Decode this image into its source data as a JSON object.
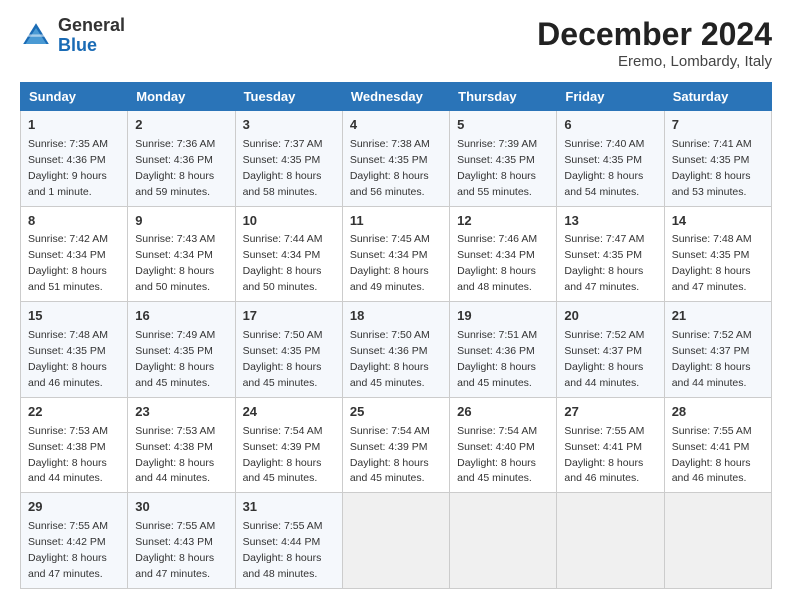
{
  "header": {
    "logo_line1": "General",
    "logo_line2": "Blue",
    "month": "December 2024",
    "location": "Eremo, Lombardy, Italy"
  },
  "days_of_week": [
    "Sunday",
    "Monday",
    "Tuesday",
    "Wednesday",
    "Thursday",
    "Friday",
    "Saturday"
  ],
  "weeks": [
    [
      {
        "day": "1",
        "info": "Sunrise: 7:35 AM\nSunset: 4:36 PM\nDaylight: 9 hours\nand 1 minute."
      },
      {
        "day": "2",
        "info": "Sunrise: 7:36 AM\nSunset: 4:36 PM\nDaylight: 8 hours\nand 59 minutes."
      },
      {
        "day": "3",
        "info": "Sunrise: 7:37 AM\nSunset: 4:35 PM\nDaylight: 8 hours\nand 58 minutes."
      },
      {
        "day": "4",
        "info": "Sunrise: 7:38 AM\nSunset: 4:35 PM\nDaylight: 8 hours\nand 56 minutes."
      },
      {
        "day": "5",
        "info": "Sunrise: 7:39 AM\nSunset: 4:35 PM\nDaylight: 8 hours\nand 55 minutes."
      },
      {
        "day": "6",
        "info": "Sunrise: 7:40 AM\nSunset: 4:35 PM\nDaylight: 8 hours\nand 54 minutes."
      },
      {
        "day": "7",
        "info": "Sunrise: 7:41 AM\nSunset: 4:35 PM\nDaylight: 8 hours\nand 53 minutes."
      }
    ],
    [
      {
        "day": "8",
        "info": "Sunrise: 7:42 AM\nSunset: 4:34 PM\nDaylight: 8 hours\nand 51 minutes."
      },
      {
        "day": "9",
        "info": "Sunrise: 7:43 AM\nSunset: 4:34 PM\nDaylight: 8 hours\nand 50 minutes."
      },
      {
        "day": "10",
        "info": "Sunrise: 7:44 AM\nSunset: 4:34 PM\nDaylight: 8 hours\nand 50 minutes."
      },
      {
        "day": "11",
        "info": "Sunrise: 7:45 AM\nSunset: 4:34 PM\nDaylight: 8 hours\nand 49 minutes."
      },
      {
        "day": "12",
        "info": "Sunrise: 7:46 AM\nSunset: 4:34 PM\nDaylight: 8 hours\nand 48 minutes."
      },
      {
        "day": "13",
        "info": "Sunrise: 7:47 AM\nSunset: 4:35 PM\nDaylight: 8 hours\nand 47 minutes."
      },
      {
        "day": "14",
        "info": "Sunrise: 7:48 AM\nSunset: 4:35 PM\nDaylight: 8 hours\nand 47 minutes."
      }
    ],
    [
      {
        "day": "15",
        "info": "Sunrise: 7:48 AM\nSunset: 4:35 PM\nDaylight: 8 hours\nand 46 minutes."
      },
      {
        "day": "16",
        "info": "Sunrise: 7:49 AM\nSunset: 4:35 PM\nDaylight: 8 hours\nand 45 minutes."
      },
      {
        "day": "17",
        "info": "Sunrise: 7:50 AM\nSunset: 4:35 PM\nDaylight: 8 hours\nand 45 minutes."
      },
      {
        "day": "18",
        "info": "Sunrise: 7:50 AM\nSunset: 4:36 PM\nDaylight: 8 hours\nand 45 minutes."
      },
      {
        "day": "19",
        "info": "Sunrise: 7:51 AM\nSunset: 4:36 PM\nDaylight: 8 hours\nand 45 minutes."
      },
      {
        "day": "20",
        "info": "Sunrise: 7:52 AM\nSunset: 4:37 PM\nDaylight: 8 hours\nand 44 minutes."
      },
      {
        "day": "21",
        "info": "Sunrise: 7:52 AM\nSunset: 4:37 PM\nDaylight: 8 hours\nand 44 minutes."
      }
    ],
    [
      {
        "day": "22",
        "info": "Sunrise: 7:53 AM\nSunset: 4:38 PM\nDaylight: 8 hours\nand 44 minutes."
      },
      {
        "day": "23",
        "info": "Sunrise: 7:53 AM\nSunset: 4:38 PM\nDaylight: 8 hours\nand 44 minutes."
      },
      {
        "day": "24",
        "info": "Sunrise: 7:54 AM\nSunset: 4:39 PM\nDaylight: 8 hours\nand 45 minutes."
      },
      {
        "day": "25",
        "info": "Sunrise: 7:54 AM\nSunset: 4:39 PM\nDaylight: 8 hours\nand 45 minutes."
      },
      {
        "day": "26",
        "info": "Sunrise: 7:54 AM\nSunset: 4:40 PM\nDaylight: 8 hours\nand 45 minutes."
      },
      {
        "day": "27",
        "info": "Sunrise: 7:55 AM\nSunset: 4:41 PM\nDaylight: 8 hours\nand 46 minutes."
      },
      {
        "day": "28",
        "info": "Sunrise: 7:55 AM\nSunset: 4:41 PM\nDaylight: 8 hours\nand 46 minutes."
      }
    ],
    [
      {
        "day": "29",
        "info": "Sunrise: 7:55 AM\nSunset: 4:42 PM\nDaylight: 8 hours\nand 47 minutes."
      },
      {
        "day": "30",
        "info": "Sunrise: 7:55 AM\nSunset: 4:43 PM\nDaylight: 8 hours\nand 47 minutes."
      },
      {
        "day": "31",
        "info": "Sunrise: 7:55 AM\nSunset: 4:44 PM\nDaylight: 8 hours\nand 48 minutes."
      },
      null,
      null,
      null,
      null
    ]
  ]
}
